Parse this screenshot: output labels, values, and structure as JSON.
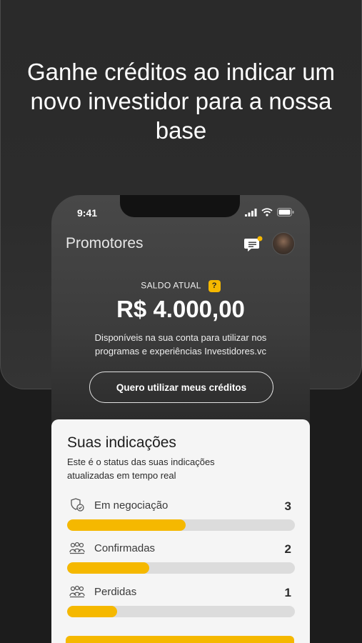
{
  "headline": "Ganhe créditos ao indicar um novo investidor para a nossa base",
  "status_bar": {
    "time": "9:41"
  },
  "app": {
    "title": "Promotores"
  },
  "balance": {
    "label": "SALDO ATUAL",
    "help": "?",
    "value": "R$ 4.000,00",
    "description": "Disponíveis na sua conta para utilizar nos programas e experiências Investidores.vc",
    "button_label": "Quero utilizar meus créditos"
  },
  "referrals": {
    "title": "Suas indicações",
    "subtitle": "Este é o status das suas indicações atualizadas em tempo real",
    "items": [
      {
        "label": "Em negociação",
        "count": "3",
        "progress": 0.52
      },
      {
        "label": "Confirmadas",
        "count": "2",
        "progress": 0.36
      },
      {
        "label": "Perdidas",
        "count": "1",
        "progress": 0.22
      }
    ]
  },
  "colors": {
    "accent": "#f5b800",
    "background": "#1c1c1c",
    "card": "#f5f5f5"
  }
}
